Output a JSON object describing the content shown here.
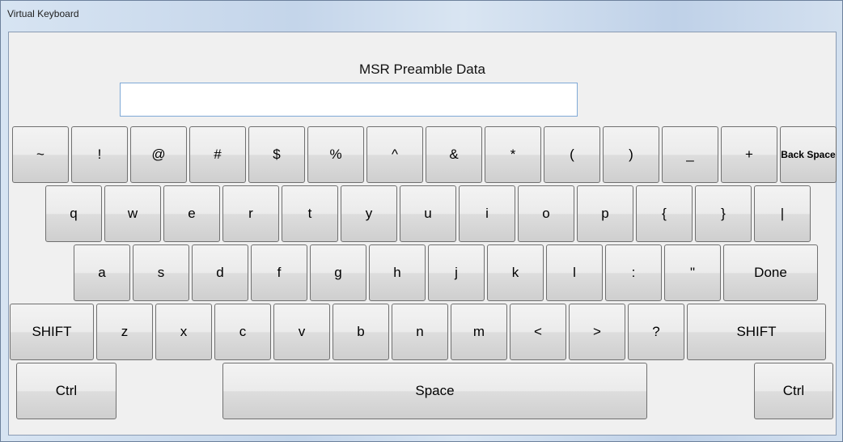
{
  "window": {
    "title": "Virtual Keyboard"
  },
  "field": {
    "label": "MSR Preamble Data",
    "value": ""
  },
  "keys": {
    "row1": [
      "~",
      "!",
      "@",
      "#",
      "$",
      "%",
      "^",
      "&",
      "*",
      "(",
      ")",
      "_",
      "+",
      "Back Space"
    ],
    "row2": [
      "q",
      "w",
      "e",
      "r",
      "t",
      "y",
      "u",
      "i",
      "o",
      "p",
      "{",
      "}",
      "|"
    ],
    "row3": [
      "a",
      "s",
      "d",
      "f",
      "g",
      "h",
      "j",
      "k",
      "l",
      ":",
      "\"",
      "Done"
    ],
    "row4": [
      "SHIFT",
      "z",
      "x",
      "c",
      "v",
      "b",
      "n",
      "m",
      "<",
      ">",
      "?",
      "SHIFT"
    ],
    "row5": [
      "Ctrl",
      "Space",
      "Ctrl"
    ]
  }
}
